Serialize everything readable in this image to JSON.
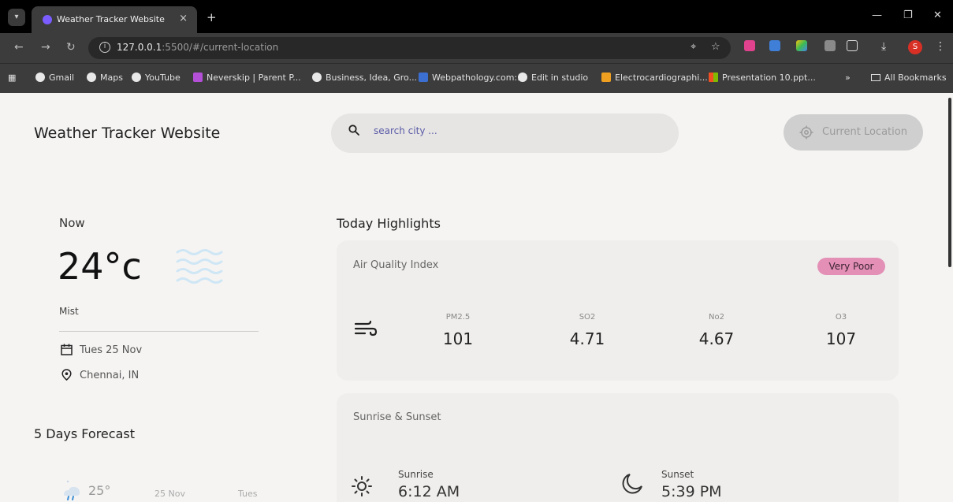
{
  "browser": {
    "tab_title": "Weather Tracker Website",
    "tab_close": "×",
    "new_tab": "+",
    "url_host": "127.0.0.1",
    "url_path": ":5500/#/current-location",
    "profile_initial": "S",
    "bookmarks": [
      {
        "label": "Gmail",
        "color": "#e8e8e8"
      },
      {
        "label": "Maps",
        "color": "#e8e8e8"
      },
      {
        "label": "YouTube",
        "color": "#e8e8e8"
      },
      {
        "label": "Neverskip | Parent P...",
        "color": "#b44fd8"
      },
      {
        "label": "Business, Idea, Gro...",
        "color": "#e8e8e8"
      },
      {
        "label": "Webpathology.com:...",
        "color": "#3b6fd1"
      },
      {
        "label": "Edit in studio",
        "color": "#e8e8e8"
      },
      {
        "label": "Electrocardiographi...",
        "color": "#f0a020"
      },
      {
        "label": "Presentation 10.ppt...",
        "color": "#f25022"
      }
    ],
    "more_bookmarks": "»",
    "all_bookmarks": "All Bookmarks"
  },
  "header": {
    "brand": "Weather Tracker Website",
    "search_placeholder": "search city ...",
    "current_location_label": "Current Location"
  },
  "now": {
    "title": "Now",
    "temperature": "24°c",
    "condition": "Mist",
    "date": "Tues 25 Nov",
    "location": "Chennai, IN"
  },
  "forecast": {
    "title": "5 Days Forecast",
    "items": [
      {
        "temp": "25°",
        "date": "25 Nov",
        "day": "Tues"
      }
    ]
  },
  "highlights": {
    "title": "Today Highlights",
    "air_quality": {
      "title": "Air Quality Index",
      "badge": "Very Poor",
      "badge_color": "#e38fb6",
      "metrics": [
        {
          "label": "PM2.5",
          "value": "101"
        },
        {
          "label": "SO2",
          "value": "4.71"
        },
        {
          "label": "No2",
          "value": "4.67"
        },
        {
          "label": "O3",
          "value": "107"
        }
      ]
    },
    "sun": {
      "title": "Sunrise & Sunset",
      "sunrise_label": "Sunrise",
      "sunrise_value": "6:12 AM",
      "sunset_label": "Sunset",
      "sunset_value": "5:39 PM"
    }
  }
}
